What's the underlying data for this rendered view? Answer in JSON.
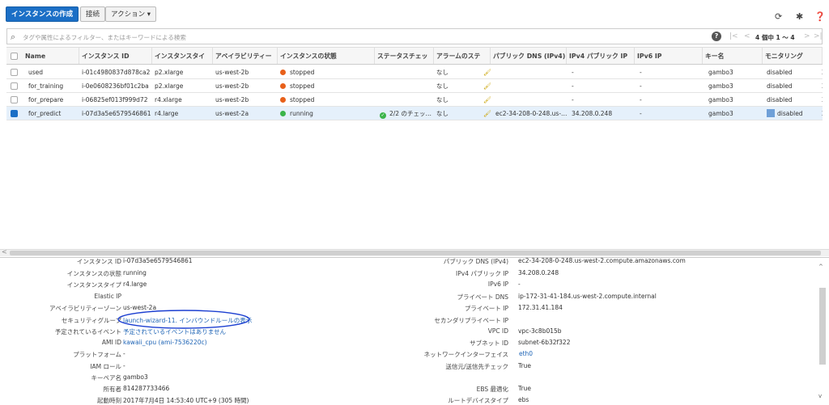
{
  "toolbar": {
    "create_label": "インスタンスの作成",
    "connect_label": "接続",
    "actions_label": "アクション ▾"
  },
  "search": {
    "placeholder": "タグや属性によるフィルター、またはキーワードによる検索",
    "pagination": "4 個中 1 〜 4"
  },
  "columns": [
    "Name",
    "インスタンス ID",
    "インスタンスタイ",
    "アベイラビリティー",
    "インスタンスの状態",
    "ステータスチェッ",
    "アラームのステ",
    "パブリック DNS (IPv4)",
    "IPv4 パブリック IP",
    "IPv6 IP",
    "キー名",
    "モニタリング"
  ],
  "rows": [
    {
      "name": "used",
      "id": "i-01c4980837d878ca2",
      "type": "p2.xlarge",
      "az": "us-west-2b",
      "state": "stopped",
      "status": "",
      "alarm": "なし",
      "dns": "",
      "ip": "-",
      "ipv6": "-",
      "key": "gambo3",
      "mon": "disabled",
      "extra": "2"
    },
    {
      "name": "for_training",
      "id": "i-0e0608236bf01c2ba",
      "type": "p2.xlarge",
      "az": "us-west-2b",
      "state": "stopped",
      "status": "",
      "alarm": "なし",
      "dns": "",
      "ip": "-",
      "ipv6": "-",
      "key": "gambo3",
      "mon": "disabled",
      "extra": "2"
    },
    {
      "name": "for_prepare",
      "id": "i-06825ef013f999d72",
      "type": "r4.xlarge",
      "az": "us-west-2b",
      "state": "stopped",
      "status": "",
      "alarm": "なし",
      "dns": "",
      "ip": "-",
      "ipv6": "-",
      "key": "gambo3",
      "mon": "disabled",
      "extra": "2"
    },
    {
      "name": "for_predict",
      "id": "i-07d3a5e6579546861",
      "type": "r4.large",
      "az": "us-west-2a",
      "state": "running",
      "status": "2/2 のチェッ…",
      "alarm": "なし",
      "dns": "ec2-34-208-0-248.us-…",
      "ip": "34.208.0.248",
      "ipv6": "-",
      "key": "gambo3",
      "mon": "disabled",
      "extra": "2"
    }
  ],
  "details": {
    "left": [
      {
        "label": "インスタンス ID",
        "value": "i-07d3a5e6579546861"
      },
      {
        "label": "インスタンスの状態",
        "value": "running"
      },
      {
        "label": "インスタンスタイプ",
        "value": "r4.large"
      },
      {
        "label": "Elastic IP",
        "value": ""
      },
      {
        "label": "アベイラビリティーゾーン",
        "value": "us-west-2a"
      },
      {
        "label": "セキュリティグループ",
        "value": "launch-wizard-11. インバウンドルールの表示"
      },
      {
        "label": "予定されているイベント",
        "value": "予定されているイベントはありません"
      },
      {
        "label": "AMI ID",
        "value": "kawaii_cpu (ami-7536220c)"
      },
      {
        "label": "プラットフォーム",
        "value": "-"
      },
      {
        "label": "IAM ロール",
        "value": "-"
      },
      {
        "label": "キーペア名",
        "value": "gambo3"
      },
      {
        "label": "所有者",
        "value": "814287733466"
      },
      {
        "label": "起動時刻",
        "value": "2017年7月4日 14:53:40 UTC+9 (305 時間)"
      }
    ],
    "right": [
      {
        "label": "パブリック DNS (IPv4)",
        "value": "ec2-34-208-0-248.us-west-2.compute.amazonaws.com"
      },
      {
        "label": "IPv4 パブリック IP",
        "value": "34.208.0.248"
      },
      {
        "label": "IPv6 IP",
        "value": "-"
      },
      {
        "label": "プライベート DNS",
        "value": "ip-172-31-41-184.us-west-2.compute.internal"
      },
      {
        "label": "プライベート IP",
        "value": "172.31.41.184"
      },
      {
        "label": "セカンダリプライベート IP",
        "value": ""
      },
      {
        "label": "VPC ID",
        "value": "vpc-3c8b015b"
      },
      {
        "label": "サブネット ID",
        "value": "subnet-6b32f322"
      },
      {
        "label": "ネットワークインターフェイス",
        "value": "eth0"
      },
      {
        "label": "送信元/送信先チェック",
        "value": "True"
      },
      {
        "label": "",
        "value": ""
      },
      {
        "label": "EBS 最適化",
        "value": "True"
      },
      {
        "label": "ルートデバイスタイプ",
        "value": "ebs"
      }
    ]
  },
  "colors": {
    "primary": "#1b6fc6",
    "stopped": "#e8601a",
    "running": "#3bb44a",
    "selected_row": "#e5f0fb",
    "link": "#1f65b6"
  }
}
